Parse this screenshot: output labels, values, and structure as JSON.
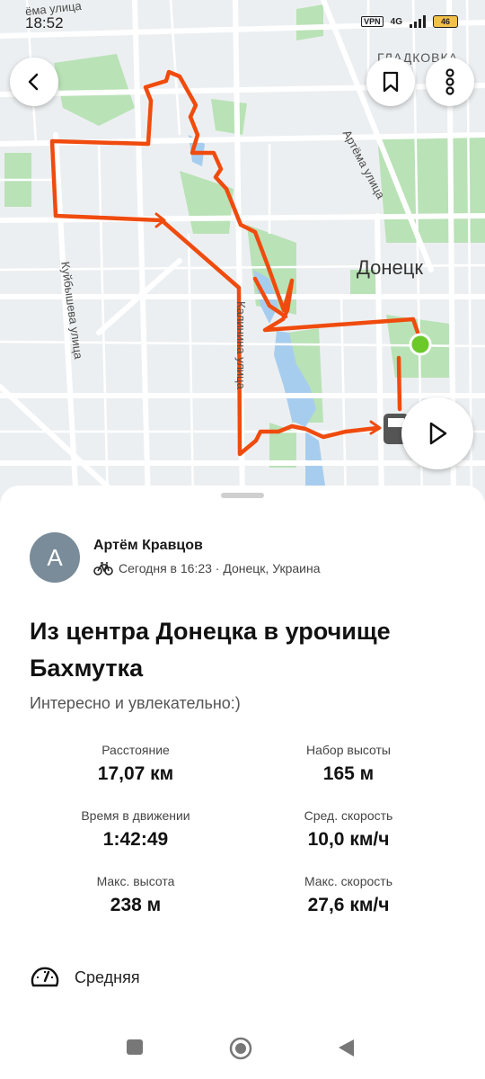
{
  "status_bar": {
    "time": "18:52",
    "vpn": "VPN",
    "network": "4G",
    "battery": "46"
  },
  "map": {
    "city_label": "Донецк",
    "district_label": "ГЛАДКОВКА",
    "top_street_label": "ёма улица",
    "streets": [
      "Артёма улица",
      "Куйбышева улица",
      "Калинина улица"
    ],
    "route_color": "#f04b0e",
    "start_color": "#6cc92a",
    "icons": {
      "back": "back-arrow-icon",
      "bookmark": "bookmark-icon",
      "more": "more-vertical-icon",
      "play": "play-icon"
    }
  },
  "activity": {
    "avatar_letter": "A",
    "athlete_name": "Артём Кравцов",
    "sport_icon": "bicycle-icon",
    "meta": "Сегодня в 16:23 · Донецк, Украина",
    "title": "Из центра Донецка в урочище Бахмутка",
    "description": "Интересно и увлекательно:)",
    "stats": [
      {
        "label": "Расстояние",
        "value": "17,07 км"
      },
      {
        "label": "Набор высоты",
        "value": "165 м"
      },
      {
        "label": "Время в движении",
        "value": "1:42:49"
      },
      {
        "label": "Сред. скорость",
        "value": "10,0 км/ч"
      },
      {
        "label": "Макс. высота",
        "value": "238 м"
      },
      {
        "label": "Макс. скорость",
        "value": "27,6 км/ч"
      }
    ],
    "difficulty_icon": "speedometer-icon",
    "difficulty": "Средняя"
  },
  "nav": {
    "recents": "square-icon",
    "home": "circle-icon",
    "back": "triangle-back-icon"
  }
}
